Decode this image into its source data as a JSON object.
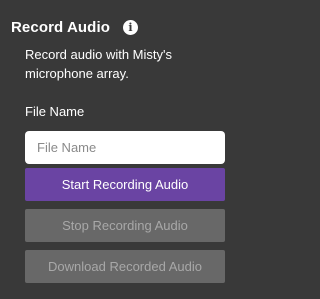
{
  "panel": {
    "title": "Record Audio",
    "info_icon": "info-icon",
    "description": "Record audio with Misty's microphone array.",
    "file_name_label": "File Name",
    "file_name_input": {
      "value": "",
      "placeholder": "File Name"
    },
    "buttons": {
      "start": "Start Recording Audio",
      "stop": "Stop Recording Audio",
      "download": "Download Recorded Audio"
    }
  },
  "colors": {
    "background": "#393939",
    "primary_button": "#6a44a3",
    "disabled_button": "#686868",
    "disabled_text": "#a8a8a8"
  }
}
